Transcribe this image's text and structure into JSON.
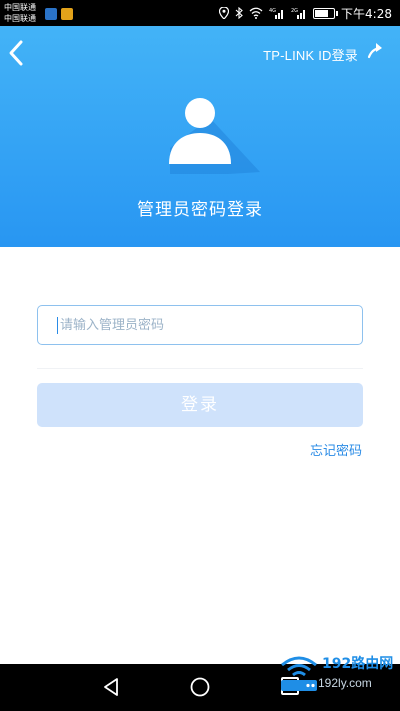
{
  "status_bar": {
    "carrier_1": "中国联通",
    "carrier_2": "中国联通",
    "network_1": "4G",
    "network_2": "2G",
    "time": "下午4:28",
    "battery_level": 0.65
  },
  "header": {
    "title": "管理员密码登录",
    "tplink_link": "TP-LINK ID登录",
    "colors": {
      "gradient_top": "#43b3f7",
      "gradient_bottom": "#2896f2"
    }
  },
  "form": {
    "password_placeholder": "请输入管理员密码",
    "password_value": "",
    "login_button": "登录",
    "forgot_link": "忘记密码",
    "colors": {
      "button_disabled": "#cfe2fb",
      "link": "#2a8be6",
      "field_border": "#8ec1ee"
    }
  },
  "icons": {
    "back": "chevron-left-icon",
    "tplink": "corner-arrow-icon",
    "avatar": "user-icon",
    "nav_back": "triangle-back-icon",
    "nav_home": "circle-home-icon",
    "nav_recent": "square-recent-icon"
  },
  "watermark": {
    "name": "192路由网",
    "domain": "192ly.com"
  }
}
